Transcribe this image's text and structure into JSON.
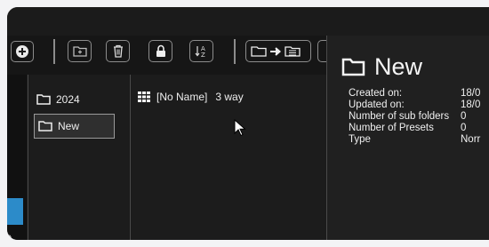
{
  "folders": [
    {
      "name": "2024",
      "selected": false
    },
    {
      "name": "New",
      "selected": true
    }
  ],
  "left_panel": {
    "partial_text": ")"
  },
  "preset": {
    "name": "[No Name]",
    "suffix": "3 way"
  },
  "detail": {
    "title": "New",
    "properties": [
      {
        "label": "Created on:",
        "value": "18/0"
      },
      {
        "label": "Updated on:",
        "value": "18/0"
      },
      {
        "label": "Number of sub folders",
        "value": "0"
      },
      {
        "label": "Number of Presets",
        "value": "0"
      },
      {
        "label": "Type",
        "value": "Norr"
      }
    ]
  },
  "colors": {
    "accent": "#2c8bc9",
    "background": "#1a1a1a"
  }
}
